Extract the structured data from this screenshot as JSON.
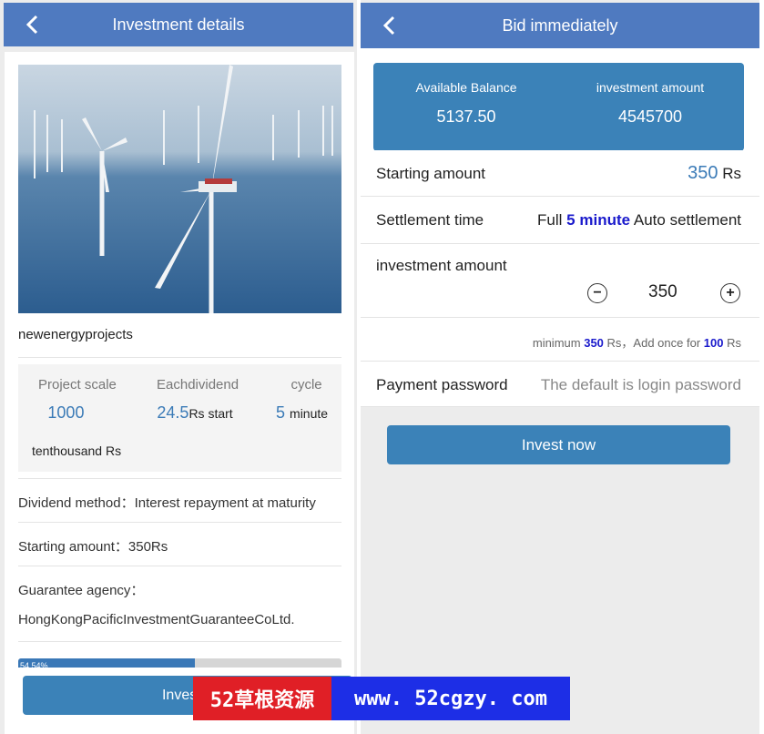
{
  "left": {
    "title": "Investment details",
    "project_name": "newenergyprojects",
    "stats": {
      "scale_label": "Project scale",
      "scale_value": "1000",
      "scale_unit": "tenthousand Rs",
      "dividend_label": "Eachdividend",
      "dividend_value": "24.5",
      "dividend_unit": "Rs start",
      "cycle_label": "cycle",
      "cycle_value": "5",
      "cycle_unit": "minute"
    },
    "dividend_method": "Dividend method：Interest repayment at maturity",
    "starting_amount": "Starting amount：350Rs",
    "guarantee_label": "Guarantee agency：",
    "guarantee_value": "HongKongPacificInvestmentGuaranteeCoLtd.",
    "progress_text": "54.54%",
    "progress_fraction": 0.5454,
    "invest_button": "Invest n"
  },
  "right": {
    "title": "Bid immediately",
    "balance_label": "Available Balance",
    "balance_value": "5137.50",
    "investment_label": "investment amount",
    "investment_value": "4545700",
    "starting_label": "Starting amount",
    "starting_value": "350",
    "starting_unit": "Rs",
    "settlement_label": "Settlement time",
    "settlement_pre": "Full",
    "settlement_num": "5 minute",
    "settlement_post": "Auto settlement",
    "amount_label": "investment amount",
    "amount_value": "350",
    "minimum_pre": "minimum",
    "minimum_num": "350",
    "minimum_mid": "Rs，Add once for",
    "minimum_step": "100",
    "minimum_unit": "Rs",
    "password_label": "Payment password",
    "password_placeholder": "The default is login password",
    "invest_button": "Invest now"
  },
  "watermark": {
    "cn": "52草根资源",
    "url": "www. 52cgzy. com"
  },
  "colors": {
    "header": "#4f7ac0",
    "accent": "#3b82b8",
    "highlight": "#1a1acc"
  }
}
